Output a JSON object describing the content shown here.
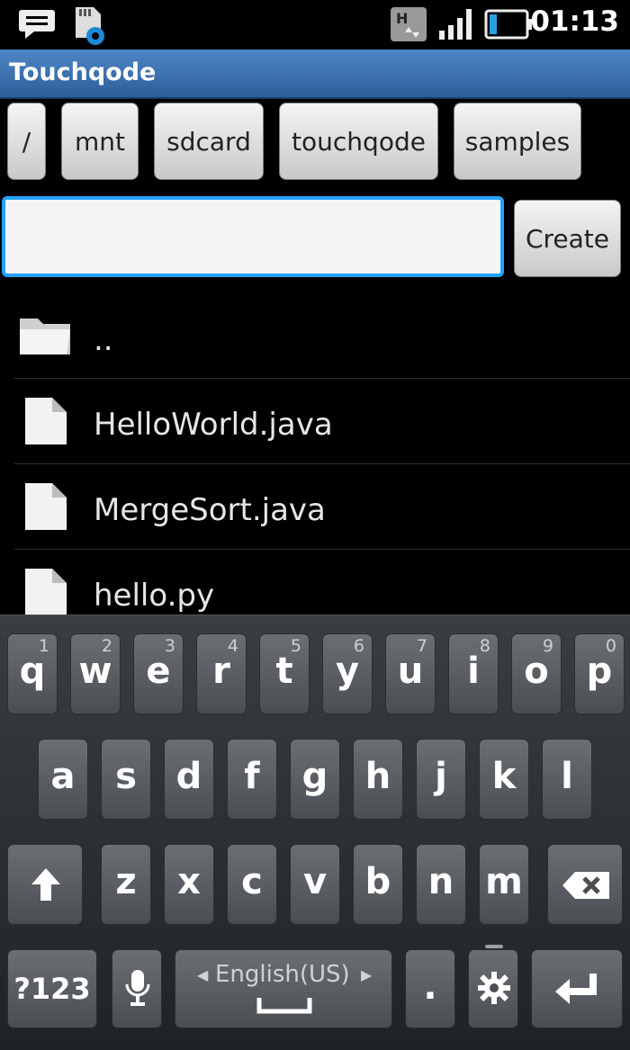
{
  "status_bar": {
    "time": "01:13",
    "icons": [
      "message-icon",
      "sd-card-settings-icon",
      "hspa-data-icon",
      "signal-icon",
      "battery-icon"
    ]
  },
  "app": {
    "title": "Touchqode"
  },
  "breadcrumbs": [
    "/",
    "mnt",
    "sdcard",
    "touchqode",
    "samples"
  ],
  "input": {
    "value": ""
  },
  "create_label": "Create",
  "files": [
    {
      "name": "..",
      "type": "folder"
    },
    {
      "name": "HelloWorld.java",
      "type": "file"
    },
    {
      "name": "MergeSort.java",
      "type": "file"
    },
    {
      "name": "hello.py",
      "type": "file"
    }
  ],
  "keyboard": {
    "row1": [
      {
        "ch": "q",
        "num": "1"
      },
      {
        "ch": "w",
        "num": "2"
      },
      {
        "ch": "e",
        "num": "3"
      },
      {
        "ch": "r",
        "num": "4"
      },
      {
        "ch": "t",
        "num": "5"
      },
      {
        "ch": "y",
        "num": "6"
      },
      {
        "ch": "u",
        "num": "7"
      },
      {
        "ch": "i",
        "num": "8"
      },
      {
        "ch": "o",
        "num": "9"
      },
      {
        "ch": "p",
        "num": "0"
      }
    ],
    "row2": [
      "a",
      "s",
      "d",
      "f",
      "g",
      "h",
      "j",
      "k",
      "l"
    ],
    "row3": [
      "z",
      "x",
      "c",
      "v",
      "b",
      "n",
      "m"
    ],
    "sym_label": "?123",
    "space_label": "English(US)",
    "period_label": "."
  }
}
